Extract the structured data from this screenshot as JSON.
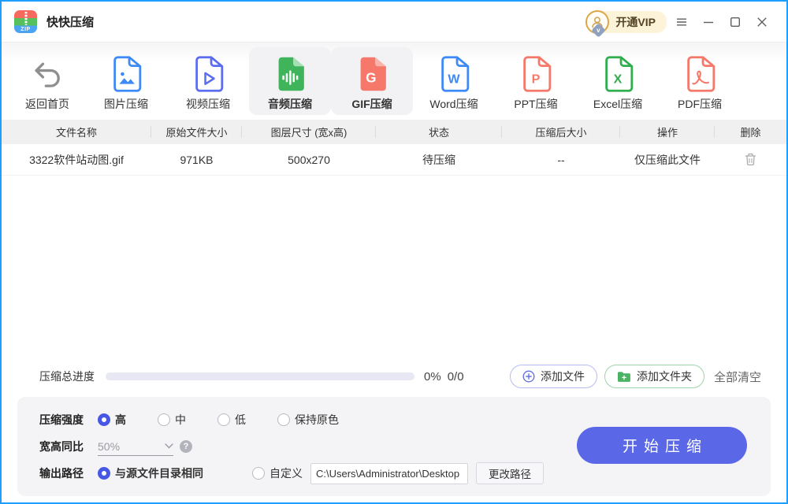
{
  "titlebar": {
    "app_title": "快快压缩",
    "logo_text": "ZIP",
    "vip_label": "开通VIP"
  },
  "toolbar": {
    "items": [
      {
        "label": "返回首页"
      },
      {
        "label": "图片压缩"
      },
      {
        "label": "视频压缩"
      },
      {
        "label": "音频压缩",
        "active": true
      },
      {
        "label": "GIF压缩",
        "active": true,
        "glyph": "G"
      },
      {
        "label": "Word压缩",
        "glyph": "W"
      },
      {
        "label": "PPT压缩",
        "glyph": "P"
      },
      {
        "label": "Excel压缩",
        "glyph": "X"
      },
      {
        "label": "PDF压缩"
      }
    ]
  },
  "table": {
    "headers": [
      "文件名称",
      "原始文件大小",
      "图层尺寸 (宽x高)",
      "状态",
      "压缩后大小",
      "操作",
      "删除"
    ],
    "row": {
      "name": "3322软件站动图.gif",
      "size": "971KB",
      "dimensions": "500x270",
      "status": "待压缩",
      "compressed_size": "--",
      "action": "仅压缩此文件"
    }
  },
  "progress": {
    "label": "压缩总进度",
    "percent": "0%",
    "count": "0/0",
    "value": 0
  },
  "actions": {
    "add_file": "添加文件",
    "add_folder": "添加文件夹",
    "clear_all": "全部清空"
  },
  "settings": {
    "strength": {
      "label": "压缩强度",
      "options": [
        {
          "label": "高",
          "selected": true
        },
        {
          "label": "中",
          "selected": false
        },
        {
          "label": "低",
          "selected": false
        },
        {
          "label": "保持原色",
          "selected": false
        }
      ]
    },
    "ratio": {
      "label": "宽高同比",
      "value": "50%",
      "help": "?"
    },
    "output": {
      "label": "输出路径",
      "same_dir": {
        "label": "与源文件目录相同",
        "selected": true
      },
      "custom": {
        "label": "自定义",
        "selected": false
      },
      "path": "C:\\Users\\Administrator\\Desktop",
      "change_button": "更改路径"
    },
    "start_button": "开始压缩"
  },
  "colors": {
    "window_border": "#1e9fff",
    "accent": "#5a68e8",
    "radio_blue": "#4757e6",
    "green": "#3fb45a",
    "salmon": "#f5786b",
    "doc_blue": "#3d8af7",
    "indigo": "#5b6cf0",
    "vip_pill_bg": "#fcf3d9",
    "avatar_ring": "#dca648",
    "header_bg": "#f0f0f0"
  }
}
